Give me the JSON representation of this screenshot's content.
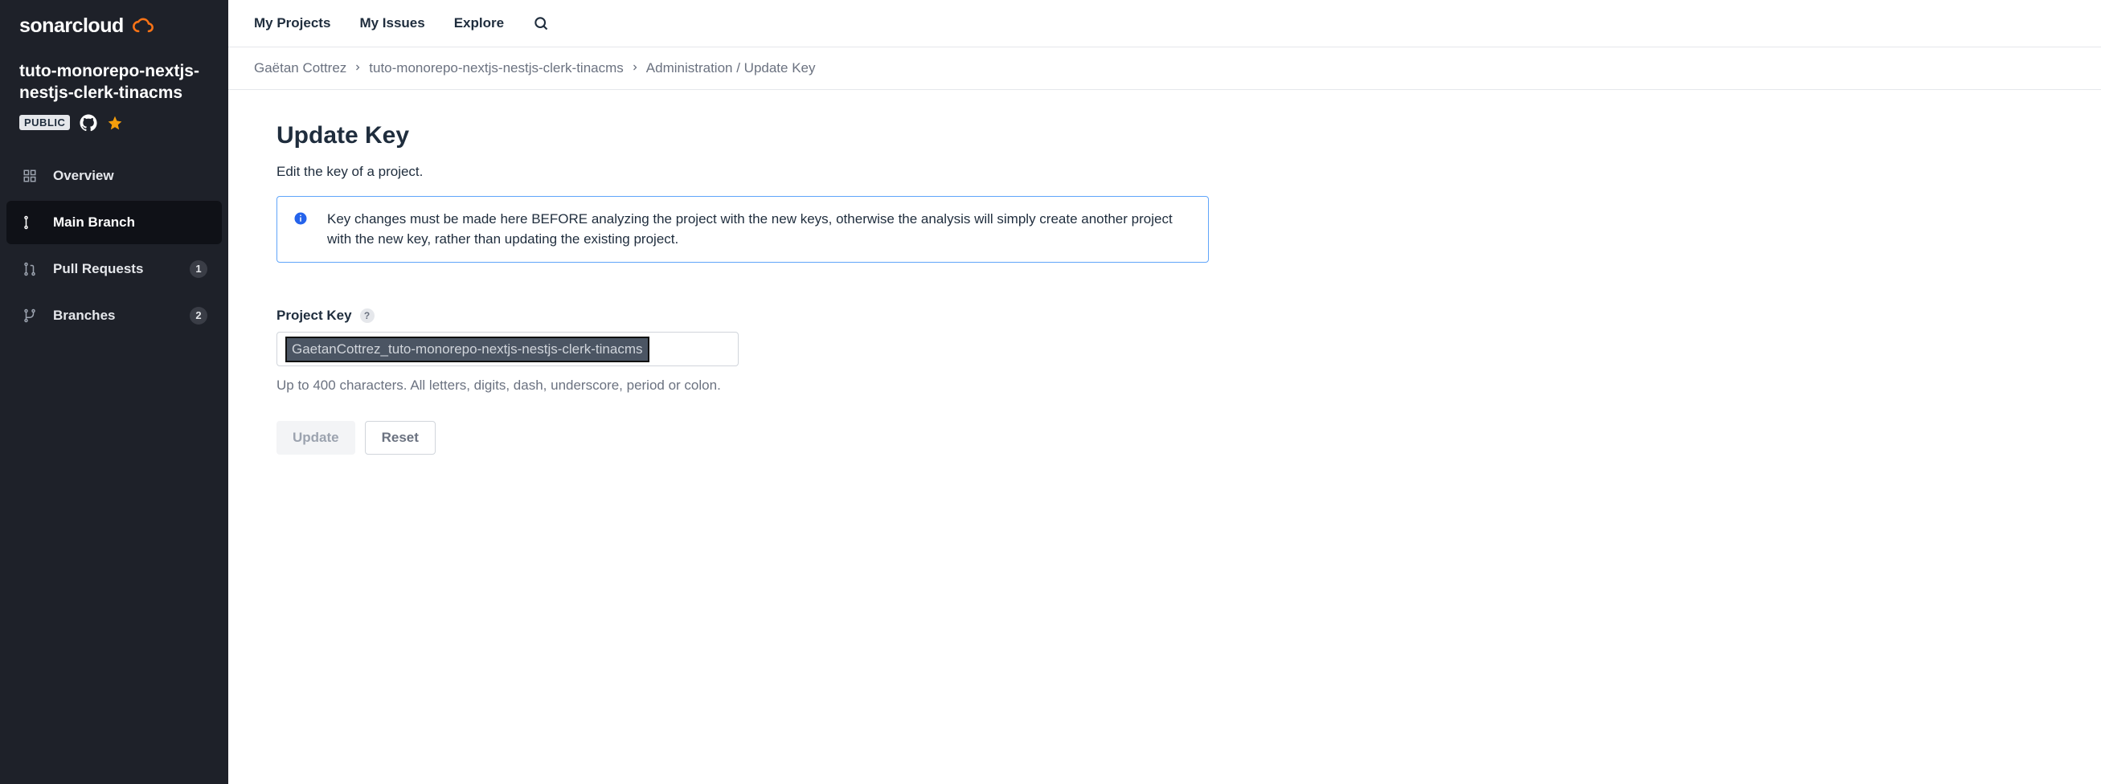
{
  "logo": {
    "text": "sonarcloud"
  },
  "sidebar": {
    "project_title": "tuto-monorepo-nextjs-nestjs-clerk-tinacms",
    "public_badge": "PUBLIC",
    "nav": [
      {
        "label": "Overview",
        "count": null
      },
      {
        "label": "Main Branch",
        "count": null
      },
      {
        "label": "Pull Requests",
        "count": "1"
      },
      {
        "label": "Branches",
        "count": "2"
      }
    ]
  },
  "topbar": {
    "links": [
      "My Projects",
      "My Issues",
      "Explore"
    ]
  },
  "breadcrumb": {
    "org": "Gaëtan Cottrez",
    "project": "tuto-monorepo-nextjs-nestjs-clerk-tinacms",
    "page": "Administration / Update Key"
  },
  "page": {
    "title": "Update Key",
    "description": "Edit the key of a project.",
    "info": "Key changes must be made here BEFORE analyzing the project with the new keys, otherwise the analysis will simply create another project with the new key, rather than updating the existing project.",
    "label": "Project Key",
    "help_char": "?",
    "key_value": "GaetanCottrez_tuto-monorepo-nextjs-nestjs-clerk-tinacms",
    "help_text": "Up to 400 characters. All letters, digits, dash, underscore, period or colon.",
    "update_btn": "Update",
    "reset_btn": "Reset"
  }
}
